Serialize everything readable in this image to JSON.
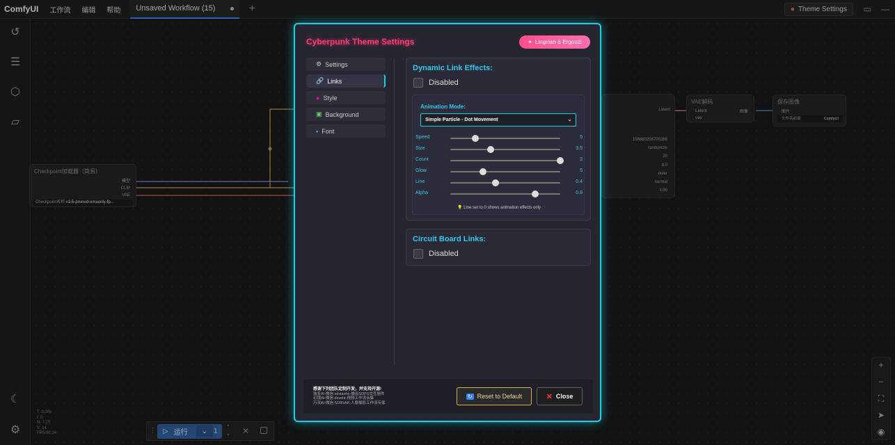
{
  "topbar": {
    "brand": "ComfyUI",
    "menu": [
      "工作流",
      "编辑",
      "帮助"
    ],
    "workflow_tab": "Unsaved Workflow (15)",
    "theme_button": "Theme Settings"
  },
  "canvas": {
    "checkpoint_node": {
      "title": "Checkpoint加载器（简易）",
      "outputs": [
        "模型",
        "CLIP",
        "VAE"
      ],
      "widget_label": "Checkpoint名称",
      "widget_value": "v1-5-pruned-emaonly-fp..."
    },
    "sampler_node": {
      "output": "Latent",
      "values": [
        "156860208700286",
        "randomize",
        "20",
        "8.0",
        "euler",
        "normal",
        "1.00"
      ]
    },
    "vae_node": {
      "title": "VAE解码",
      "inputs": [
        "Latent",
        "vae"
      ],
      "output": "图像"
    },
    "save_node": {
      "title": "保存图像",
      "input": "图片",
      "widget_label": "文件名前缀",
      "widget_value": "ComfyUI"
    },
    "stats": [
      "T: 0.00s",
      "I: 0",
      "N: 7 [7]",
      "V: 14",
      "FPS:60.24"
    ]
  },
  "runbar": {
    "run_label": "运行",
    "count": "1"
  },
  "modal": {
    "title": "Cyberpunk Theme Settings",
    "author_badge": "Lingxian & Ergouzi",
    "tabs": [
      {
        "label": "Settings",
        "icon": "gear-icon"
      },
      {
        "label": "Links",
        "icon": "link-icon"
      },
      {
        "label": "Style",
        "icon": "palette-icon"
      },
      {
        "label": "Background",
        "icon": "image-icon"
      },
      {
        "label": "Font",
        "icon": "font-icon"
      }
    ],
    "active_tab": "Links",
    "dynamic_links": {
      "title": "Dynamic Link Effects:",
      "enabled_label": "Disabled",
      "animation_mode_label": "Animation Mode:",
      "animation_mode_value": "Simple Particle - Dot Movement",
      "sliders": [
        {
          "label": "Speed",
          "value": "5",
          "fraction": 0.23
        },
        {
          "label": "Size",
          "value": "3.5",
          "fraction": 0.37
        },
        {
          "label": "Count",
          "value": "3",
          "fraction": 1.0
        },
        {
          "label": "Glow",
          "value": "5",
          "fraction": 0.3
        },
        {
          "label": "Line",
          "value": "0.4",
          "fraction": 0.41
        },
        {
          "label": "Alpha",
          "value": "0.8",
          "fraction": 0.77
        }
      ],
      "hint": "Line set to 0 shows animation effects only"
    },
    "circuit_links": {
      "title": "Circuit Board Links:",
      "enabled_label": "Disabled"
    },
    "footer": {
      "thanks": "感谢下列团队定制开发，并支持开源!",
      "lines": [
        "独变AI-微信:sdxiaohe-推出SDPS交互插件",
        "幻镜AI-微信:dsvetir-视频工作流合集",
        "万灵AI-微信:SD8SAK-人像摄影工作流专家"
      ],
      "reset_label": "Reset to Default",
      "close_label": "Close"
    }
  },
  "colors": {
    "modal_border": "#19d0e6",
    "title_accent": "#ff3b6f",
    "label_cyan": "#33c7ee",
    "reset_border": "#d2b354"
  }
}
